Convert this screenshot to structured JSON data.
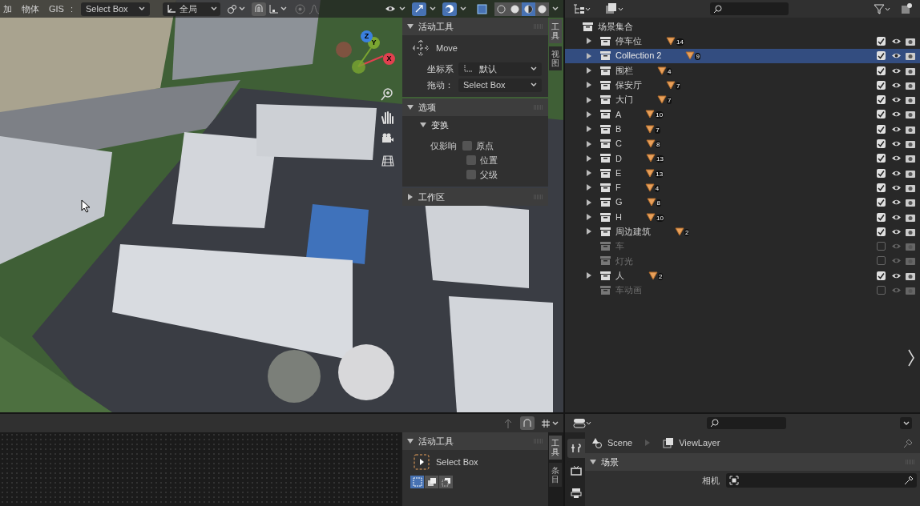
{
  "viewport_header": {
    "menus": [
      "加",
      "物体",
      "GIS"
    ],
    "colon": ":",
    "select_mode": "Select Box",
    "orientation": "全局",
    "snap_on": true,
    "overlays_on": true,
    "shading": [
      {
        "selected": false
      },
      {
        "selected": false
      },
      {
        "selected": true
      },
      {
        "selected": false
      }
    ]
  },
  "gizmo": [
    {
      "axis": "X",
      "color": "#e2404f"
    },
    {
      "axis": "Y",
      "color": "#7ba531"
    },
    {
      "axis": "Z",
      "color": "#3b80e0"
    }
  ],
  "n_panel": {
    "side_tabs": [
      {
        "label": "工具",
        "selected": true
      },
      {
        "label": "视图",
        "selected": false
      }
    ],
    "active_tool": {
      "title": "活动工具",
      "expanded": true,
      "tool": "Move",
      "fields": [
        {
          "label": "坐标系",
          "value": "默认"
        },
        {
          "label": "拖动：",
          "value": "Select Box"
        }
      ]
    },
    "options": {
      "title": "选项",
      "expanded": true,
      "subpanel": "变换",
      "affect_label": "仅影响",
      "checkboxes": [
        {
          "label": "原点",
          "checked": false
        },
        {
          "label": "位置",
          "checked": false
        },
        {
          "label": "父级",
          "checked": false
        }
      ]
    },
    "workspace": {
      "title": "工作区",
      "expanded": false
    }
  },
  "outliner": {
    "root": "场景集合",
    "rows": [
      {
        "name": "停车位",
        "count": "14",
        "expandable": true,
        "enabled": true,
        "selected": false
      },
      {
        "name": "Collection 2",
        "count": "9",
        "expandable": true,
        "enabled": true,
        "selected": true
      },
      {
        "name": "围栏",
        "count": "4",
        "expandable": true,
        "enabled": true,
        "selected": false
      },
      {
        "name": "保安厅",
        "count": "7",
        "expandable": true,
        "enabled": true,
        "selected": false
      },
      {
        "name": "大门",
        "count": "7",
        "expandable": true,
        "enabled": true,
        "selected": false
      },
      {
        "name": "A",
        "count": "10",
        "expandable": true,
        "enabled": true,
        "selected": false
      },
      {
        "name": "B",
        "count": "7",
        "expandable": true,
        "enabled": true,
        "selected": false
      },
      {
        "name": "C",
        "count": "8",
        "expandable": true,
        "enabled": true,
        "selected": false
      },
      {
        "name": "D",
        "count": "13",
        "expandable": true,
        "enabled": true,
        "selected": false
      },
      {
        "name": "E",
        "count": "13",
        "expandable": true,
        "enabled": true,
        "selected": false
      },
      {
        "name": "F",
        "count": "4",
        "expandable": true,
        "enabled": true,
        "selected": false
      },
      {
        "name": "G",
        "count": "8",
        "expandable": true,
        "enabled": true,
        "selected": false
      },
      {
        "name": "H",
        "count": "10",
        "expandable": true,
        "enabled": true,
        "selected": false
      },
      {
        "name": "周边建筑",
        "count": "2",
        "expandable": true,
        "enabled": true,
        "selected": false
      },
      {
        "name": "车",
        "expandable": false,
        "enabled": false,
        "selected": false
      },
      {
        "name": "灯光",
        "expandable": false,
        "enabled": false,
        "selected": false
      },
      {
        "name": "人",
        "count": "2",
        "expandable": true,
        "enabled": true,
        "selected": false
      },
      {
        "name": "车动画",
        "expandable": false,
        "enabled": false,
        "selected": false
      }
    ]
  },
  "bottom_panel": {
    "side_tabs": [
      {
        "label": "工具",
        "selected": true
      },
      {
        "label": "条目",
        "selected": false
      }
    ],
    "title": "活动工具",
    "expanded": true,
    "tool": "Select Box",
    "modes": [
      {
        "selected": true
      },
      {
        "selected": false
      },
      {
        "selected": false
      }
    ]
  },
  "properties": {
    "tabs": [
      {
        "selected": true
      },
      {
        "selected": false
      },
      {
        "selected": false
      }
    ],
    "breadcrumb": [
      "Scene",
      "ViewLayer"
    ],
    "panel": {
      "title": "场景",
      "expanded": true,
      "field_label": "相机"
    }
  }
}
